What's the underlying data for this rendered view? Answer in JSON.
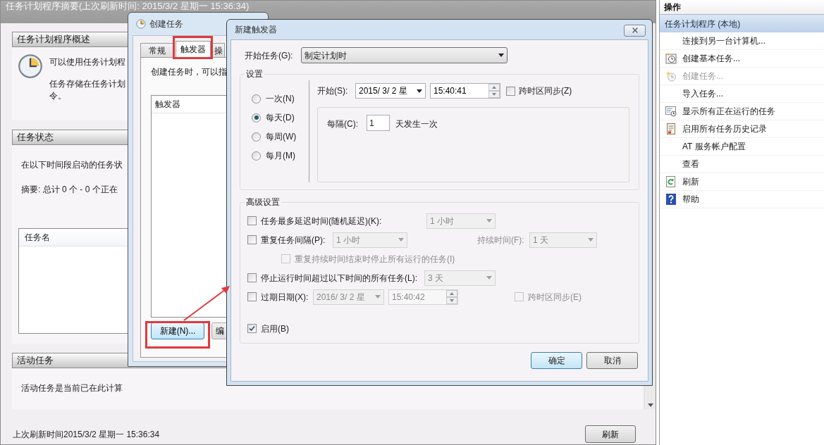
{
  "main": {
    "title": "任务计划程序摘要(上次刷新时间: 2015/3/2 星期一 15:36:34)",
    "sections": [
      {
        "title": "任务计划程序概述",
        "paragraphs": [
          [
            "可以使用任务计划程"
          ],
          [
            "任务存储在任务计划",
            "令。"
          ]
        ]
      },
      {
        "title": "任务状态",
        "paragraphs": [
          [
            "在以下时间段启动的任务状"
          ],
          [
            "摘要: 总计 0 个 - 0 个正在"
          ]
        ],
        "table": {
          "columns": [
            "任务名"
          ]
        }
      },
      {
        "title": "活动任务",
        "paragraphs": [
          [
            "活动任务是当前已在此计算"
          ]
        ]
      }
    ],
    "footer": {
      "text": "上次刷新时间2015/3/2 星期一 15:36:34",
      "button": "刷新"
    }
  },
  "actions": {
    "title": "操作",
    "group": {
      "label": "任务计划程序 (本地)",
      "selected": true
    },
    "items": [
      {
        "label": "连接到另一台计算机...",
        "disabled": false
      },
      {
        "label": "创建基本任务...",
        "disabled": false
      },
      {
        "label": "创建任务...",
        "disabled": true
      },
      {
        "label": "导入任务...",
        "disabled": false
      },
      {
        "label": "显示所有正在运行的任务",
        "disabled": false
      },
      {
        "label": "启用所有任务历史记录",
        "disabled": false
      },
      {
        "label": "AT 服务帐户配置",
        "disabled": false
      },
      {
        "label": "查看",
        "disabled": false
      },
      {
        "label": "刷新",
        "disabled": false
      },
      {
        "label": "帮助",
        "disabled": false
      }
    ]
  },
  "create_task": {
    "title": "创建任务",
    "tabs": [
      {
        "label": "常规",
        "selected": false
      },
      {
        "label": "触发器",
        "selected": true
      },
      {
        "label": "操",
        "selected": false
      }
    ],
    "description": "创建任务时，可以指",
    "list_header": "触发器",
    "buttons": [
      "新建(N)...",
      "编"
    ]
  },
  "new_trigger": {
    "title": "新建触发器",
    "begin_label": "开始任务(G):",
    "begin_value": "制定计划时",
    "settings": {
      "legend": "设置",
      "schedules": [
        {
          "label": "一次(N)",
          "selected": false
        },
        {
          "label": "每天(D)",
          "selected": true
        },
        {
          "label": "每周(W)",
          "selected": false
        },
        {
          "label": "每月(M)",
          "selected": false
        }
      ],
      "start_label": "开始(S):",
      "start_date": "2015/  3/  2 星",
      "start_time": "15:40:41",
      "sync_label": "跨时区同步(Z)",
      "sync_checked": false,
      "recur_label": "每隔(C):",
      "recur_value": "1",
      "recur_unit": "天发生一次"
    },
    "advanced": {
      "legend": "高级设置",
      "delay": {
        "label": "任务最多延迟时间(随机延迟)(K):",
        "checked": false,
        "value": "1 小时",
        "disabled": true
      },
      "repeat": {
        "label": "重复任务间隔(P):",
        "checked": false,
        "value": "1 小时",
        "disabled": true,
        "duration_label": "持续时间(F):",
        "duration_value": "1 天"
      },
      "stop_repeat": {
        "label": "重复持续时间结束时停止所有运行的任务(I)",
        "checked": false,
        "disabled": true
      },
      "stop_long": {
        "label": "停止运行时间超过以下时间的所有任务(L):",
        "checked": false,
        "value": "3 天",
        "disabled": true
      },
      "expire": {
        "label": "过期日期(X):",
        "checked": false,
        "date": "2016/  3/  2 星",
        "time": "15:40:42",
        "disabled": true,
        "sync_label": "跨时区同步(E)",
        "sync_checked": false
      },
      "enabled": {
        "label": "启用(B)",
        "checked": true
      }
    },
    "buttons": [
      {
        "label": "确定",
        "default": true
      },
      {
        "label": "取消",
        "default": false
      }
    ]
  }
}
